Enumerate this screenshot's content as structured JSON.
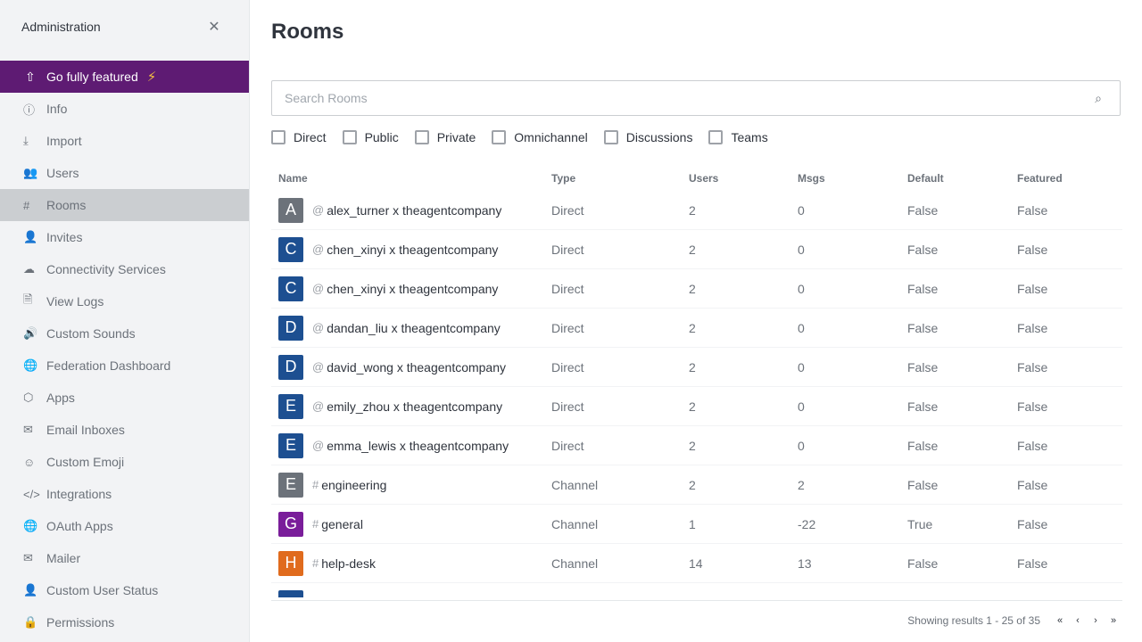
{
  "sidebar": {
    "title": "Administration",
    "featured_label": "Go fully featured",
    "items": [
      {
        "label": "Info",
        "icon": "info-icon",
        "glyph": "ⓘ",
        "active": false
      },
      {
        "label": "Import",
        "icon": "import-icon",
        "glyph": "⤓",
        "active": false
      },
      {
        "label": "Users",
        "icon": "users-icon",
        "glyph": "👥",
        "active": false
      },
      {
        "label": "Rooms",
        "icon": "hashtag-icon",
        "glyph": "#",
        "active": true
      },
      {
        "label": "Invites",
        "icon": "user-plus-icon",
        "glyph": "👤",
        "active": false
      },
      {
        "label": "Connectivity Services",
        "icon": "cloud-icon",
        "glyph": "☁",
        "active": false
      },
      {
        "label": "View Logs",
        "icon": "file-icon",
        "glyph": "🗎",
        "active": false
      },
      {
        "label": "Custom Sounds",
        "icon": "volume-icon",
        "glyph": "🔊",
        "active": false
      },
      {
        "label": "Federation Dashboard",
        "icon": "globe-icon",
        "glyph": "🌐",
        "active": false
      },
      {
        "label": "Apps",
        "icon": "cube-icon",
        "glyph": "⬡",
        "active": false
      },
      {
        "label": "Email Inboxes",
        "icon": "mail-icon",
        "glyph": "✉",
        "active": false
      },
      {
        "label": "Custom Emoji",
        "icon": "emoji-icon",
        "glyph": "☺",
        "active": false
      },
      {
        "label": "Integrations",
        "icon": "code-icon",
        "glyph": "</>",
        "active": false
      },
      {
        "label": "OAuth Apps",
        "icon": "globe-icon",
        "glyph": "🌐",
        "active": false
      },
      {
        "label": "Mailer",
        "icon": "mail-icon",
        "glyph": "✉",
        "active": false
      },
      {
        "label": "Custom User Status",
        "icon": "user-icon",
        "glyph": "👤",
        "active": false
      },
      {
        "label": "Permissions",
        "icon": "lock-icon",
        "glyph": "🔒",
        "active": false
      }
    ]
  },
  "main": {
    "title": "Rooms",
    "search_placeholder": "Search Rooms",
    "filters": [
      "Direct",
      "Public",
      "Private",
      "Omnichannel",
      "Discussions",
      "Teams"
    ],
    "columns": [
      "Name",
      "Type",
      "Users",
      "Msgs",
      "Default",
      "Featured"
    ],
    "rows": [
      {
        "letter": "A",
        "color": "#6c727a",
        "prefix": "@",
        "name": "alex_turner x theagentcompany",
        "type": "Direct",
        "users": "2",
        "msgs": "0",
        "default": "False",
        "featured": "False"
      },
      {
        "letter": "C",
        "color": "#1d4f91",
        "prefix": "@",
        "name": "chen_xinyi x theagentcompany",
        "type": "Direct",
        "users": "2",
        "msgs": "0",
        "default": "False",
        "featured": "False"
      },
      {
        "letter": "C",
        "color": "#1d4f91",
        "prefix": "@",
        "name": "chen_xinyi x theagentcompany",
        "type": "Direct",
        "users": "2",
        "msgs": "0",
        "default": "False",
        "featured": "False"
      },
      {
        "letter": "D",
        "color": "#1d4f91",
        "prefix": "@",
        "name": "dandan_liu x theagentcompany",
        "type": "Direct",
        "users": "2",
        "msgs": "0",
        "default": "False",
        "featured": "False"
      },
      {
        "letter": "D",
        "color": "#1d4f91",
        "prefix": "@",
        "name": "david_wong x theagentcompany",
        "type": "Direct",
        "users": "2",
        "msgs": "0",
        "default": "False",
        "featured": "False"
      },
      {
        "letter": "E",
        "color": "#1d4f91",
        "prefix": "@",
        "name": "emily_zhou x theagentcompany",
        "type": "Direct",
        "users": "2",
        "msgs": "0",
        "default": "False",
        "featured": "False"
      },
      {
        "letter": "E",
        "color": "#1d4f91",
        "prefix": "@",
        "name": "emma_lewis x theagentcompany",
        "type": "Direct",
        "users": "2",
        "msgs": "0",
        "default": "False",
        "featured": "False"
      },
      {
        "letter": "E",
        "color": "#6c727a",
        "prefix": "#",
        "name": "engineering",
        "type": "Channel",
        "users": "2",
        "msgs": "2",
        "default": "False",
        "featured": "False"
      },
      {
        "letter": "G",
        "color": "#7a1d9a",
        "prefix": "#",
        "name": "general",
        "type": "Channel",
        "users": "1",
        "msgs": "-22",
        "default": "True",
        "featured": "False"
      },
      {
        "letter": "H",
        "color": "#e06b1d",
        "prefix": "#",
        "name": "help-desk",
        "type": "Channel",
        "users": "14",
        "msgs": "13",
        "default": "False",
        "featured": "False"
      }
    ],
    "partial_row_color": "#1d4f91",
    "results_text": "Showing results 1 - 25 of 35",
    "pager": [
      "«",
      "‹",
      "›",
      "»"
    ]
  },
  "colors": {
    "accent_purple": "#5e1b73",
    "bolt": "#f5c242",
    "active_item": "#cbced1"
  }
}
